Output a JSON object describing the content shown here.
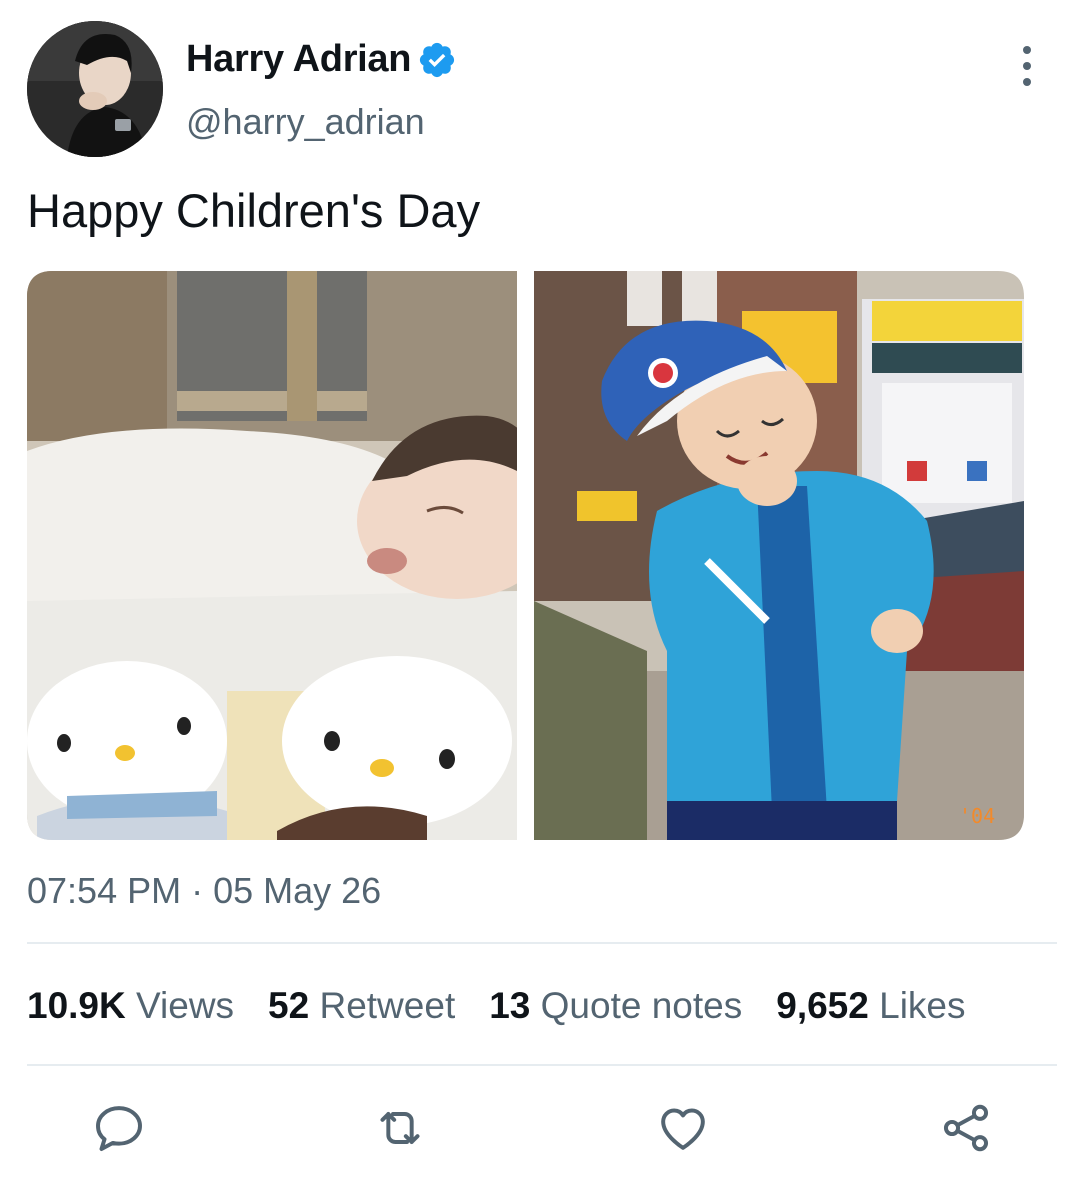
{
  "user": {
    "display_name": "Harry Adrian",
    "handle": "@harry_adrian",
    "verified": true,
    "avatar_description": "profile photo"
  },
  "tweet": {
    "text": "Happy Children's Day",
    "timestamp": "07:54 PM · 05 May 26"
  },
  "media": {
    "left_photo": "baby sleeping on Hello Kitty plush toys",
    "right_photo": "child in blue jacket and cap posing on street",
    "right_photo_stamp": "'04"
  },
  "stats": {
    "views": {
      "value": "10.9K",
      "label": "Views"
    },
    "retweets": {
      "value": "52",
      "label": "Retweet"
    },
    "quotes": {
      "value": "13",
      "label": "Quote notes"
    },
    "likes": {
      "value": "9,652",
      "label": "Likes"
    }
  },
  "actions": [
    "reply-icon",
    "retweet-icon",
    "like-icon",
    "share-icon"
  ],
  "colors": {
    "verified": "#1d9bf0",
    "secondary_text": "#536471",
    "primary_text": "#0f1419",
    "divider": "#e6ecf0"
  }
}
